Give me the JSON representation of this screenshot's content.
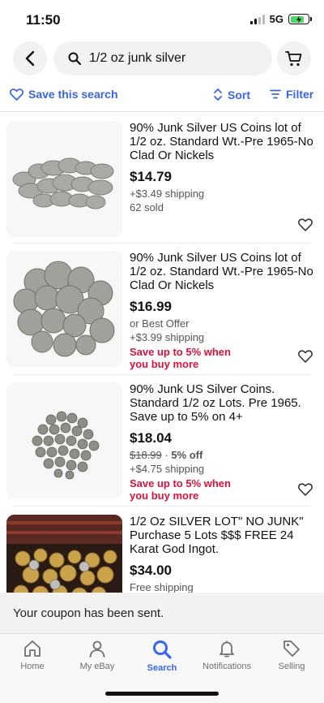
{
  "status": {
    "time": "11:50",
    "network": "5G"
  },
  "header": {
    "search_query": "1/2 oz junk silver"
  },
  "toolbar": {
    "save_label": "Save this search",
    "sort_label": "Sort",
    "filter_label": "Filter"
  },
  "listings": [
    {
      "title": "90% Junk Silver US Coins lot of 1/2 oz. Standard Wt.-Pre 1965-No Clad Or Nickels",
      "price": "$14.79",
      "shipping": "+$3.49 shipping",
      "sold": "62 sold"
    },
    {
      "title": "90% Junk Silver US Coins lot of 1/2 oz. Standard Wt.-Pre 1965-No Clad Or Nickels",
      "price": "$16.99",
      "offer": "or Best Offer",
      "shipping": "+$3.99 shipping",
      "promo": "Save up to 5% when you buy more"
    },
    {
      "title": "90% Junk US Silver Coins. Standard 1/2 oz Lots. Pre 1965. Save up to 5% on 4+",
      "price": "$18.04",
      "original_price": "$18.99",
      "discount": "5% off",
      "shipping": "+$4.75 shipping",
      "promo": "Save up to 5% when you buy more"
    },
    {
      "title": "1/2 Oz SILVER LOT\" NO JUNK\" Purchase 5 Lots $$$ FREE 24 Karat God Ingot.",
      "price": "$34.00",
      "shipping": "Free shipping"
    }
  ],
  "toast": {
    "message": "Your coupon has been sent."
  },
  "tabs": [
    {
      "label": "Home",
      "icon": "home-icon"
    },
    {
      "label": "My eBay",
      "icon": "person-icon"
    },
    {
      "label": "Search",
      "icon": "search-icon",
      "active": true
    },
    {
      "label": "Notifications",
      "icon": "bell-icon"
    },
    {
      "label": "Selling",
      "icon": "tag-icon"
    }
  ],
  "colors": {
    "accent": "#3665f3",
    "promo": "#e0103a",
    "battery": "#4cd964"
  }
}
